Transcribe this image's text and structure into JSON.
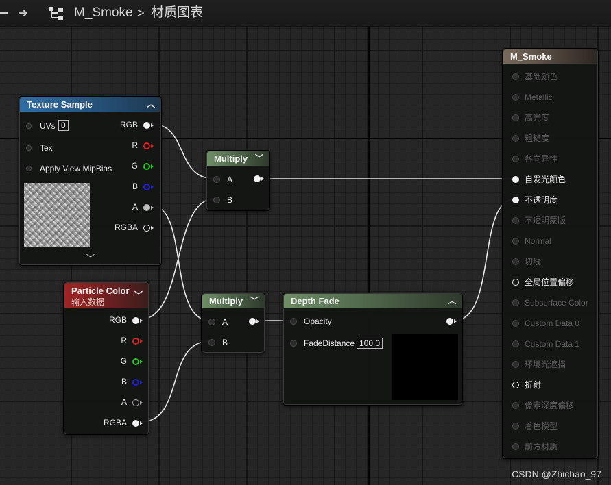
{
  "breadcrumb": {
    "asset": "M_Smoke",
    "separator": ">",
    "graph": "材质图表"
  },
  "nodes": {
    "texture_sample": {
      "title": "Texture Sample",
      "inputs": [
        {
          "label": "UVs",
          "value": "0"
        },
        {
          "label": "Tex"
        },
        {
          "label": "Apply View MipBias"
        }
      ],
      "outputs": [
        "RGB",
        "R",
        "G",
        "B",
        "A",
        "RGBA"
      ]
    },
    "particle_color": {
      "title": "Particle Color",
      "subtitle": "输入数据",
      "outputs": [
        "RGB",
        "R",
        "G",
        "B",
        "A",
        "RGBA"
      ]
    },
    "multiply_top": {
      "title": "Multiply",
      "inputs": [
        "A",
        "B"
      ]
    },
    "multiply_bottom": {
      "title": "Multiply",
      "inputs": [
        "A",
        "B"
      ]
    },
    "depth_fade": {
      "title": "Depth Fade",
      "inputs": [
        {
          "label": "Opacity"
        },
        {
          "label": "FadeDistance",
          "value": "100.0"
        }
      ]
    },
    "material_result": {
      "title": "M_Smoke",
      "pins": [
        {
          "label": "基础颜色",
          "enabled": false
        },
        {
          "label": "Metallic",
          "enabled": false
        },
        {
          "label": "高光度",
          "enabled": false
        },
        {
          "label": "粗糙度",
          "enabled": false
        },
        {
          "label": "各向异性",
          "enabled": false
        },
        {
          "label": "自发光颜色",
          "enabled": true,
          "connected": true
        },
        {
          "label": "不透明度",
          "enabled": true,
          "connected": true
        },
        {
          "label": "不透明蒙版",
          "enabled": false
        },
        {
          "label": "Normal",
          "enabled": false
        },
        {
          "label": "切线",
          "enabled": false
        },
        {
          "label": "全局位置偏移",
          "enabled": true,
          "connected": false
        },
        {
          "label": "Subsurface Color",
          "enabled": false
        },
        {
          "label": "Custom Data 0",
          "enabled": false
        },
        {
          "label": "Custom Data 1",
          "enabled": false
        },
        {
          "label": "环境光遮挡",
          "enabled": false
        },
        {
          "label": "折射",
          "enabled": true,
          "connected": false
        },
        {
          "label": "像素深度偏移",
          "enabled": false
        },
        {
          "label": "着色模型",
          "enabled": false
        },
        {
          "label": "前方材质",
          "enabled": false
        }
      ]
    }
  },
  "colors": {
    "texture_header": "#2f6fa8",
    "multiply_header": "#6e8e66",
    "particle_header": "#a02424",
    "result_header": "#7a6a5c",
    "pin_red": "#dd2222",
    "pin_green": "#22cc22",
    "pin_blue": "#2222cc"
  },
  "watermark": "CSDN @Zhichao_97"
}
